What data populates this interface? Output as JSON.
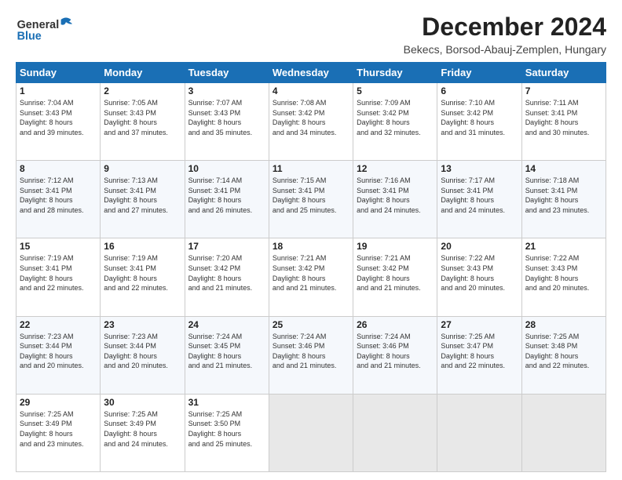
{
  "header": {
    "logo_line1": "General",
    "logo_line2": "Blue",
    "month": "December 2024",
    "location": "Bekecs, Borsod-Abauj-Zemplen, Hungary"
  },
  "days_of_week": [
    "Sunday",
    "Monday",
    "Tuesday",
    "Wednesday",
    "Thursday",
    "Friday",
    "Saturday"
  ],
  "weeks": [
    [
      {
        "num": "1",
        "sunrise": "7:04 AM",
        "sunset": "3:43 PM",
        "daylight": "8 hours and 39 minutes."
      },
      {
        "num": "2",
        "sunrise": "7:05 AM",
        "sunset": "3:43 PM",
        "daylight": "8 hours and 37 minutes."
      },
      {
        "num": "3",
        "sunrise": "7:07 AM",
        "sunset": "3:43 PM",
        "daylight": "8 hours and 35 minutes."
      },
      {
        "num": "4",
        "sunrise": "7:08 AM",
        "sunset": "3:42 PM",
        "daylight": "8 hours and 34 minutes."
      },
      {
        "num": "5",
        "sunrise": "7:09 AM",
        "sunset": "3:42 PM",
        "daylight": "8 hours and 32 minutes."
      },
      {
        "num": "6",
        "sunrise": "7:10 AM",
        "sunset": "3:42 PM",
        "daylight": "8 hours and 31 minutes."
      },
      {
        "num": "7",
        "sunrise": "7:11 AM",
        "sunset": "3:41 PM",
        "daylight": "8 hours and 30 minutes."
      }
    ],
    [
      {
        "num": "8",
        "sunrise": "7:12 AM",
        "sunset": "3:41 PM",
        "daylight": "8 hours and 28 minutes."
      },
      {
        "num": "9",
        "sunrise": "7:13 AM",
        "sunset": "3:41 PM",
        "daylight": "8 hours and 27 minutes."
      },
      {
        "num": "10",
        "sunrise": "7:14 AM",
        "sunset": "3:41 PM",
        "daylight": "8 hours and 26 minutes."
      },
      {
        "num": "11",
        "sunrise": "7:15 AM",
        "sunset": "3:41 PM",
        "daylight": "8 hours and 25 minutes."
      },
      {
        "num": "12",
        "sunrise": "7:16 AM",
        "sunset": "3:41 PM",
        "daylight": "8 hours and 24 minutes."
      },
      {
        "num": "13",
        "sunrise": "7:17 AM",
        "sunset": "3:41 PM",
        "daylight": "8 hours and 24 minutes."
      },
      {
        "num": "14",
        "sunrise": "7:18 AM",
        "sunset": "3:41 PM",
        "daylight": "8 hours and 23 minutes."
      }
    ],
    [
      {
        "num": "15",
        "sunrise": "7:19 AM",
        "sunset": "3:41 PM",
        "daylight": "8 hours and 22 minutes."
      },
      {
        "num": "16",
        "sunrise": "7:19 AM",
        "sunset": "3:41 PM",
        "daylight": "8 hours and 22 minutes."
      },
      {
        "num": "17",
        "sunrise": "7:20 AM",
        "sunset": "3:42 PM",
        "daylight": "8 hours and 21 minutes."
      },
      {
        "num": "18",
        "sunrise": "7:21 AM",
        "sunset": "3:42 PM",
        "daylight": "8 hours and 21 minutes."
      },
      {
        "num": "19",
        "sunrise": "7:21 AM",
        "sunset": "3:42 PM",
        "daylight": "8 hours and 21 minutes."
      },
      {
        "num": "20",
        "sunrise": "7:22 AM",
        "sunset": "3:43 PM",
        "daylight": "8 hours and 20 minutes."
      },
      {
        "num": "21",
        "sunrise": "7:22 AM",
        "sunset": "3:43 PM",
        "daylight": "8 hours and 20 minutes."
      }
    ],
    [
      {
        "num": "22",
        "sunrise": "7:23 AM",
        "sunset": "3:44 PM",
        "daylight": "8 hours and 20 minutes."
      },
      {
        "num": "23",
        "sunrise": "7:23 AM",
        "sunset": "3:44 PM",
        "daylight": "8 hours and 20 minutes."
      },
      {
        "num": "24",
        "sunrise": "7:24 AM",
        "sunset": "3:45 PM",
        "daylight": "8 hours and 21 minutes."
      },
      {
        "num": "25",
        "sunrise": "7:24 AM",
        "sunset": "3:46 PM",
        "daylight": "8 hours and 21 minutes."
      },
      {
        "num": "26",
        "sunrise": "7:24 AM",
        "sunset": "3:46 PM",
        "daylight": "8 hours and 21 minutes."
      },
      {
        "num": "27",
        "sunrise": "7:25 AM",
        "sunset": "3:47 PM",
        "daylight": "8 hours and 22 minutes."
      },
      {
        "num": "28",
        "sunrise": "7:25 AM",
        "sunset": "3:48 PM",
        "daylight": "8 hours and 22 minutes."
      }
    ],
    [
      {
        "num": "29",
        "sunrise": "7:25 AM",
        "sunset": "3:49 PM",
        "daylight": "8 hours and 23 minutes."
      },
      {
        "num": "30",
        "sunrise": "7:25 AM",
        "sunset": "3:49 PM",
        "daylight": "8 hours and 24 minutes."
      },
      {
        "num": "31",
        "sunrise": "7:25 AM",
        "sunset": "3:50 PM",
        "daylight": "8 hours and 25 minutes."
      },
      null,
      null,
      null,
      null
    ]
  ]
}
